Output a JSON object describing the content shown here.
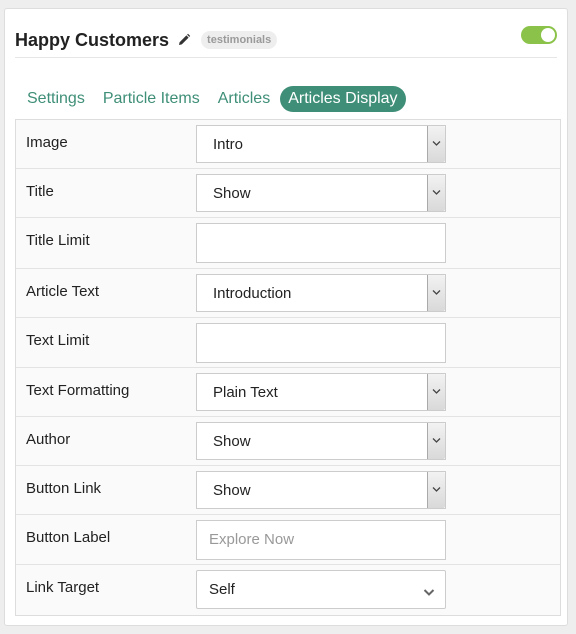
{
  "header": {
    "title": "Happy Customers",
    "badge": "testimonials"
  },
  "tabs": [
    {
      "label": "Settings"
    },
    {
      "label": "Particle Items"
    },
    {
      "label": "Articles"
    },
    {
      "label": "Articles Display"
    }
  ],
  "rows": [
    {
      "label": "Image",
      "value": "Intro"
    },
    {
      "label": "Title",
      "value": "Show"
    },
    {
      "label": "Title Limit",
      "value": ""
    },
    {
      "label": "Article Text",
      "value": "Introduction"
    },
    {
      "label": "Text Limit",
      "value": ""
    },
    {
      "label": "Text Formatting",
      "value": "Plain Text"
    },
    {
      "label": "Author",
      "value": "Show"
    },
    {
      "label": "Button Link",
      "value": "Show"
    },
    {
      "label": "Button Label",
      "placeholder": "Explore Now"
    },
    {
      "label": "Link Target",
      "value": "Self"
    }
  ],
  "colors": {
    "accent": "#3f8f78",
    "toggle_on": "#8bc34a"
  },
  "icons": {
    "edit": "pencil-icon",
    "select": "chevron-down-icon"
  }
}
